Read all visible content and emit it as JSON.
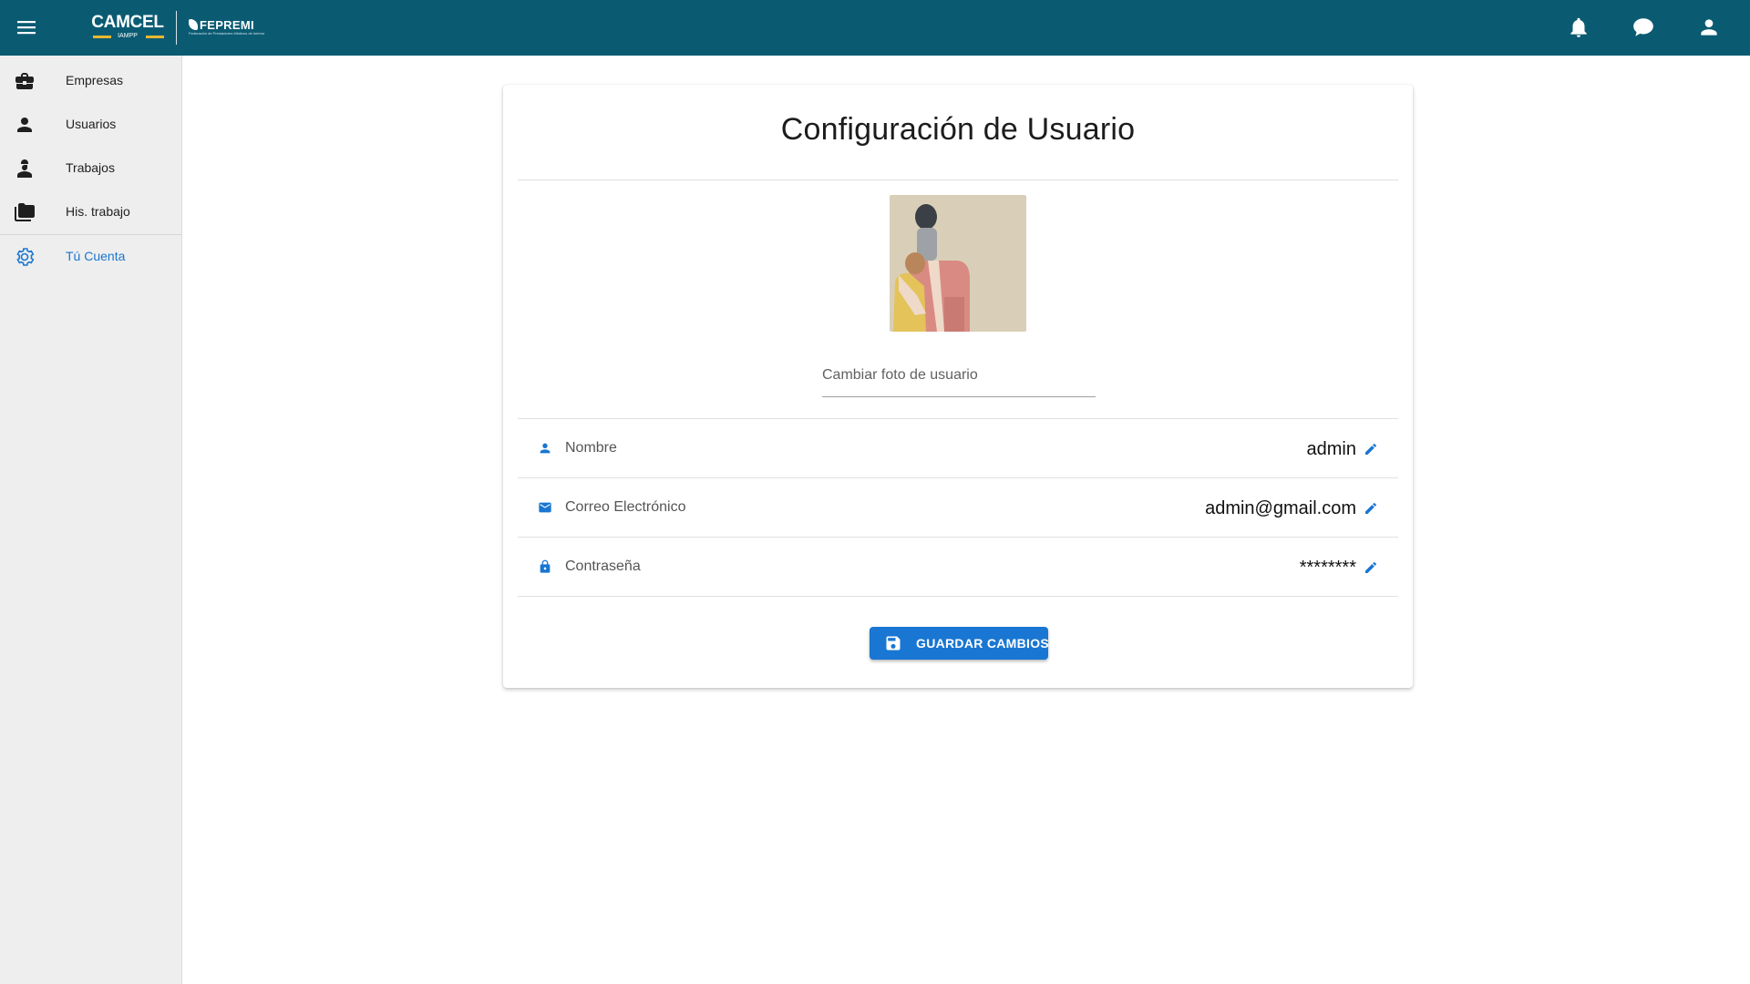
{
  "header": {
    "brand_primary": "CAMCEL",
    "brand_primary_sub": "IAMPP",
    "brand_secondary": "FEPREMI",
    "brand_secondary_tagline": "Federación de Prestadores Médicos de Interior",
    "icons": [
      "menu-icon",
      "bell-icon",
      "chat-icon",
      "account-icon"
    ],
    "background_color": "#0a5b72"
  },
  "sidebar": {
    "items": [
      {
        "label": "Empresas",
        "icon": "briefcase-icon"
      },
      {
        "label": "Usuarios",
        "icon": "person-icon"
      },
      {
        "label": "Trabajos",
        "icon": "worker-icon"
      },
      {
        "label": "His. trabajo",
        "icon": "folder-icon"
      },
      {
        "label": "Tú Cuenta",
        "icon": "gear-icon",
        "active": true
      }
    ]
  },
  "main": {
    "title": "Configuración de Usuario",
    "change_photo_label": "Cambiar foto de usuario",
    "fields": [
      {
        "label": "Nombre",
        "value": "admin",
        "icon": "person-icon"
      },
      {
        "label": "Correo Electrónico",
        "value": "admin@gmail.com",
        "icon": "mail-icon"
      },
      {
        "label": "Contraseña",
        "value": "********",
        "icon": "lock-icon"
      }
    ],
    "save_label": "GUARDAR CAMBIOS"
  },
  "colors": {
    "accent": "#1976d2",
    "sidebar_bg": "#eeeeee",
    "brand_yellow": "#e8b82e"
  }
}
